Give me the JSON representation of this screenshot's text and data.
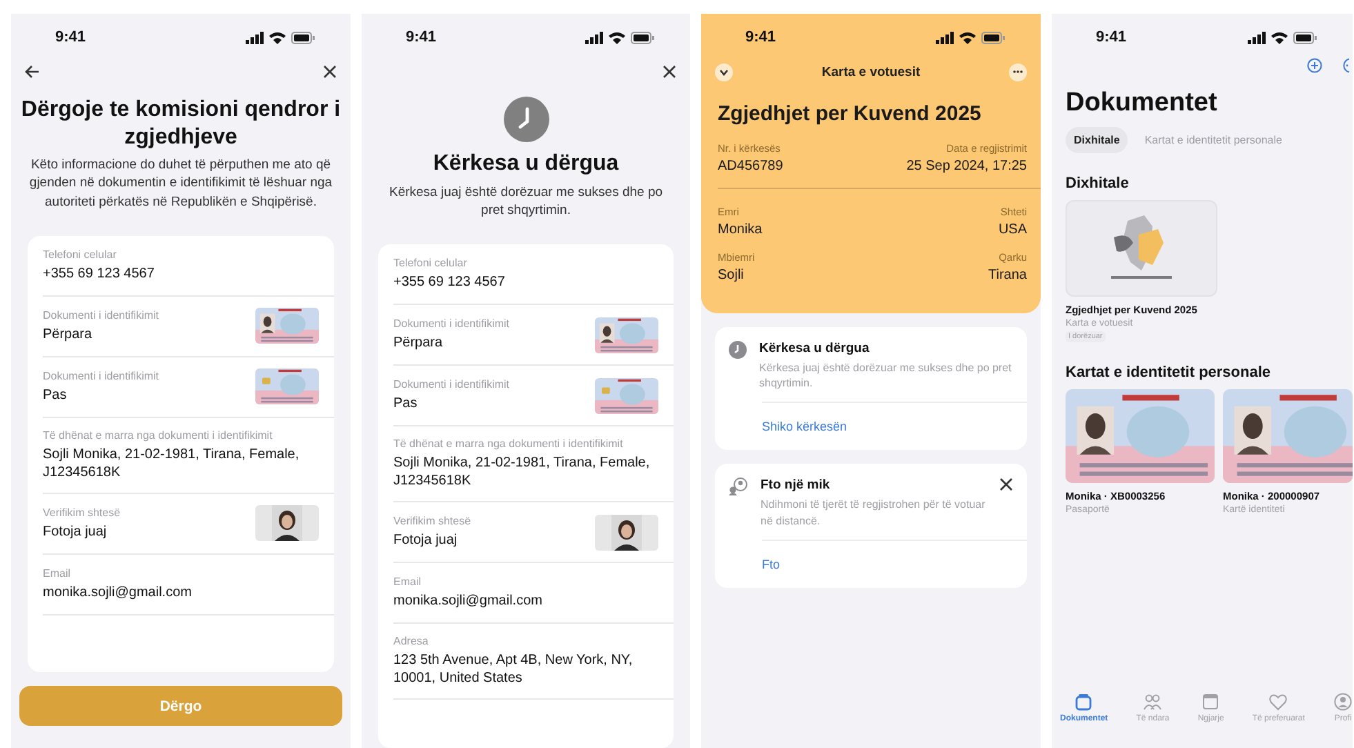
{
  "submit_screen": {
    "time": "9:41",
    "title": "Dërgoje te komisioni qendror i zgjedhjeve",
    "subtitle": "Këto informacione do duhet të përputhen me ato që gjenden në dokumentin e identifikimit të lëshuar nga autoriteti përkatës në Republikën e Shqipërisë.",
    "fields": [
      {
        "kind": "text",
        "label": "Telefoni celular",
        "value": "+355 69 123 4567"
      },
      {
        "kind": "picture",
        "label": "Dokumenti i identifikimit",
        "value": "Përpara"
      },
      {
        "kind": "picture",
        "label": "Dokumenti i identifikimit",
        "value": "Pas"
      },
      {
        "kind": "text",
        "label": "Të dhënat e marra nga dokumenti i identifikimit",
        "value": "Sojli Monika, 21-02-1981, Tirana, Female, J12345618K"
      },
      {
        "kind": "picture",
        "label": "Verifikim shtesë",
        "value": "Fotoja juaj"
      },
      {
        "kind": "text",
        "label": "Email",
        "value": "monika.sojli@gmail.com"
      }
    ],
    "button": "Dërgo"
  },
  "sent_screen": {
    "time": "9:41",
    "title": "Kërkesa u dërgua",
    "subtitle": "Kërkesa juaj është dorëzuar me sukses dhe po pret shqyrtimin.",
    "fields": [
      {
        "kind": "text",
        "label": "Telefoni celular",
        "value": "+355 69 123 4567"
      },
      {
        "kind": "picture",
        "label": "Dokumenti i identifikimit",
        "value": "Përpara"
      },
      {
        "kind": "picture",
        "label": "Dokumenti i identifikimit",
        "value": "Pas"
      },
      {
        "kind": "text",
        "label": "Të dhënat e marra nga dokumenti i identifikimit",
        "value": "Sojli Monika, 21-02-1981, Tirana, Female, J12345618K"
      },
      {
        "kind": "picture",
        "label": "Verifikim shtesë",
        "value": "Fotoja juaj"
      },
      {
        "kind": "text",
        "label": "Email",
        "value": "monika.sojli@gmail.com"
      },
      {
        "kind": "text",
        "label": "Adresa",
        "value": "123 5th Avenue, Apt 4B, New York, NY, 10001, United States"
      }
    ]
  },
  "voter_card_screen": {
    "time": "9:41",
    "header_title": "Karta e votuesit",
    "election": "Zgjedhjet per Kuvend 2025",
    "detail_rows": [
      {
        "left": {
          "label": "Nr. i kërkesës",
          "value": "AD456789"
        },
        "right": {
          "label": "Data e regjistrimit",
          "value": "25 Sep 2024, 17:25"
        }
      },
      {
        "left": {
          "label": "Emri",
          "value": "Monika"
        },
        "right": {
          "label": "Shteti",
          "value": "USA"
        }
      },
      {
        "left": {
          "label": "Mbiemri",
          "value": "Sojli"
        },
        "right": {
          "label": "Qarku",
          "value": "Tirana"
        }
      }
    ],
    "notices": [
      {
        "kind": "status",
        "title": "Kërkesa u dërgua",
        "text": "Kërkesa juaj është dorëzuar me sukses dhe po pret shqyrtimin.",
        "link": "Shiko kërkesën"
      },
      {
        "kind": "invite",
        "title": "Fto një mik",
        "text": "Ndihmoni të tjerët të regjistrohen për të votuar në distancë.",
        "link": "Fto"
      }
    ]
  },
  "documents_screen": {
    "time": "9:41",
    "title": "Dokumentet",
    "chips": [
      {
        "label": "Dixhitale",
        "selected": true
      },
      {
        "label": "Kartat e identitetit personale",
        "selected": false
      }
    ],
    "digital": {
      "heading": "Dixhitale",
      "items": [
        {
          "title": "Zgjedhjet per Kuvend 2025",
          "subtitle": "Karta e votuesit",
          "badge": "I dorëzuar"
        }
      ]
    },
    "id_cards": {
      "heading": "Kartat e identitetit personale",
      "items": [
        {
          "title": "Monika · XB0003256",
          "subtitle": "Pasaportë"
        },
        {
          "title": "Monika · 200000907",
          "subtitle": "Kartë identiteti"
        }
      ]
    },
    "tab_bar": [
      {
        "label": "Dokumentet",
        "selected": true
      },
      {
        "label": "Të ndara",
        "selected": false
      },
      {
        "label": "Ngjarje",
        "selected": false
      },
      {
        "label": "Të preferuarat",
        "selected": false
      },
      {
        "label": "Profi",
        "selected": false
      }
    ]
  }
}
